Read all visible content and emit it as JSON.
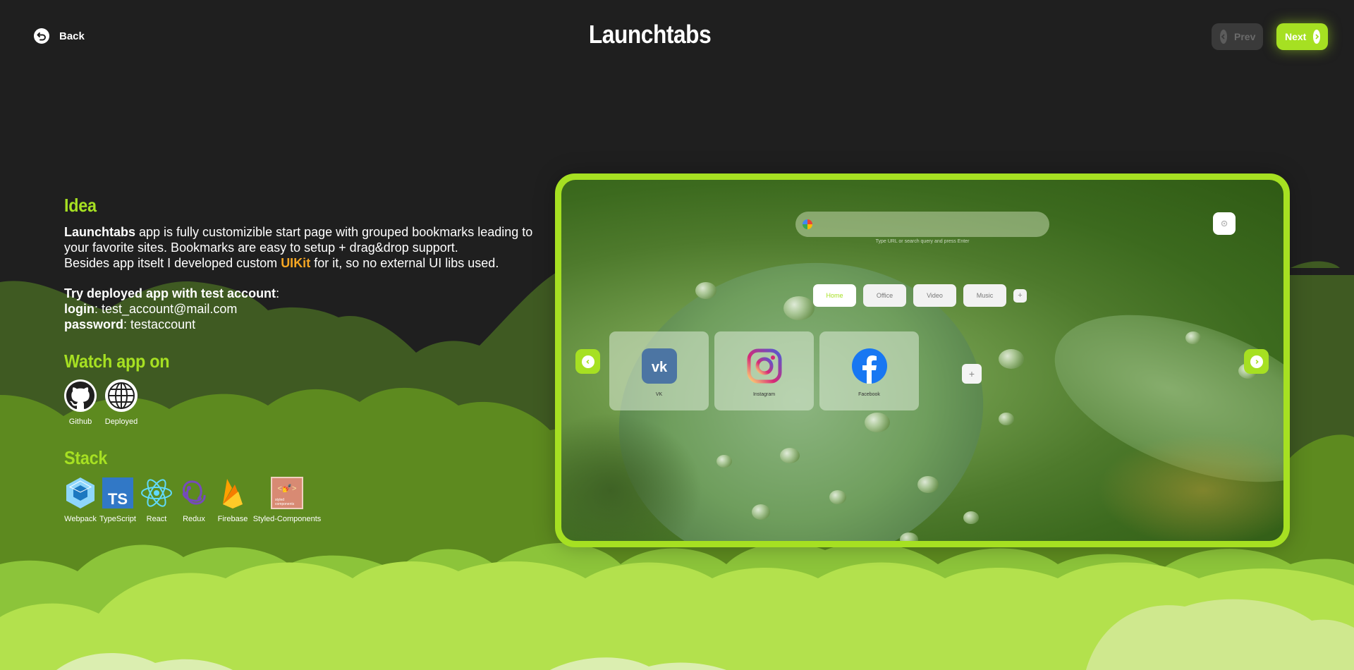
{
  "header": {
    "back_label": "Back",
    "title": "Launchtabs",
    "prev_label": "Prev",
    "next_label": "Next"
  },
  "idea": {
    "heading": "Idea",
    "app_name": "Launchtabs",
    "line1_rest": " app is fully customizible start page with grouped bookmarks leading to your favorite sites. Bookmarks are easy to setup + drag&drop support.",
    "line3_start": "Besides app itselt I developed custom ",
    "uikit": "UIKit",
    "line3_end": " for it, so no external UI libs used.",
    "try_label": "Try deployed app with test account",
    "login_label": "login",
    "login_value": "test_account@mail.com",
    "password_label": "password",
    "password_value": "testaccount"
  },
  "watch": {
    "heading": "Watch app on",
    "items": [
      {
        "label": "Github",
        "icon": "github-icon"
      },
      {
        "label": "Deployed",
        "icon": "globe-icon"
      }
    ]
  },
  "stack": {
    "heading": "Stack",
    "items": [
      {
        "label": "Webpack",
        "icon": "webpack-icon"
      },
      {
        "label": "TypeScript",
        "icon": "typescript-icon"
      },
      {
        "label": "React",
        "icon": "react-icon"
      },
      {
        "label": "Redux",
        "icon": "redux-icon"
      },
      {
        "label": "Firebase",
        "icon": "firebase-icon"
      },
      {
        "label": "Styled-Components",
        "icon": "styled-components-icon"
      }
    ]
  },
  "mockup": {
    "search_hint": "Type URL or search query and press Enter",
    "tabs": [
      "Home",
      "Office",
      "Video",
      "Music"
    ],
    "cards": [
      "VK",
      "Instagram",
      "Facebook"
    ]
  },
  "colors": {
    "background": "#1f1f1f",
    "accent": "#a6e022",
    "highlight": "#f5a623"
  }
}
